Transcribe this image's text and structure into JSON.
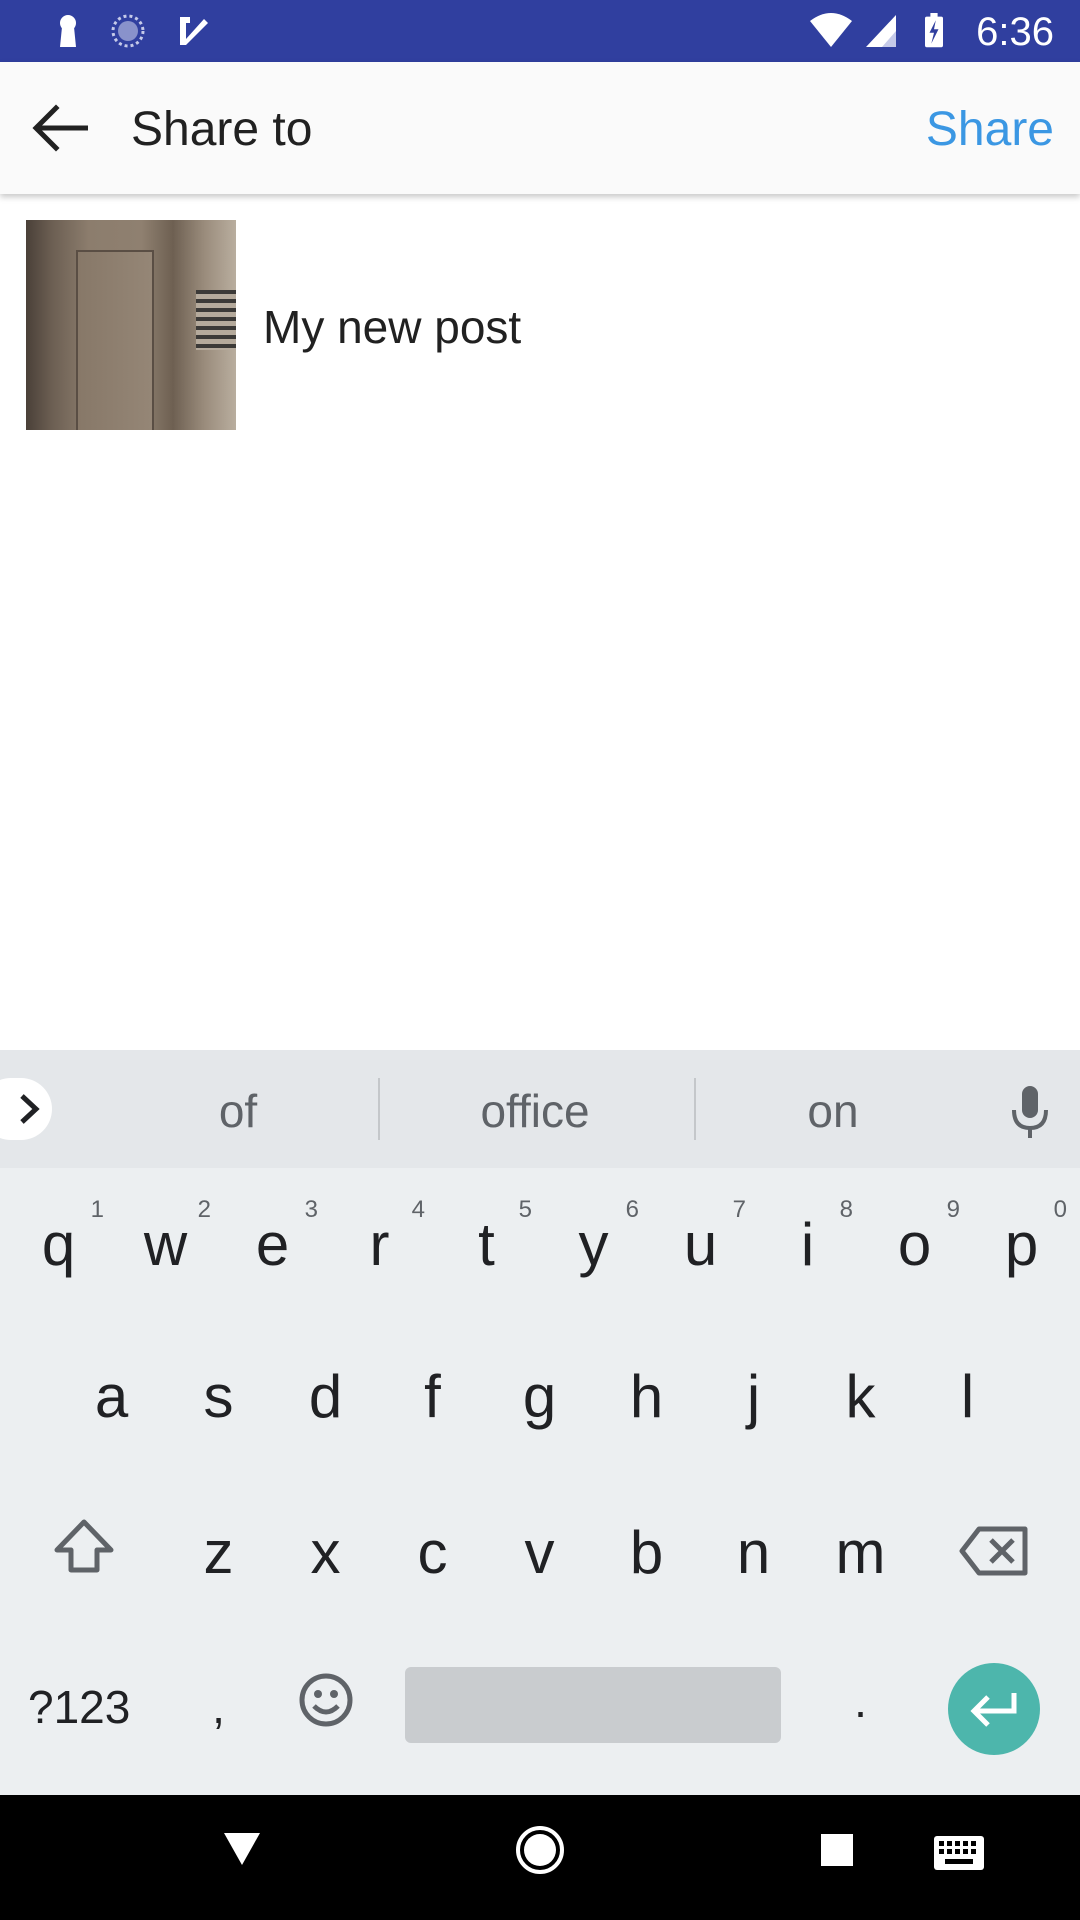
{
  "status_bar": {
    "time": "6:36",
    "icons_left": [
      "keyhole-icon",
      "loading-circle-icon",
      "check-icon"
    ],
    "icons_right": [
      "wifi-icon",
      "signal-icon",
      "battery-charging-icon"
    ],
    "bg_color": "#303f9f"
  },
  "app_bar": {
    "back_icon": "arrow-back-icon",
    "title": "Share to",
    "action_label": "Share",
    "action_color": "#3b97e3"
  },
  "post": {
    "caption": "My new post"
  },
  "keyboard": {
    "suggestions": [
      "of",
      "office",
      "on"
    ],
    "row1": [
      {
        "letter": "q",
        "hint": "1"
      },
      {
        "letter": "w",
        "hint": "2"
      },
      {
        "letter": "e",
        "hint": "3"
      },
      {
        "letter": "r",
        "hint": "4"
      },
      {
        "letter": "t",
        "hint": "5"
      },
      {
        "letter": "y",
        "hint": "6"
      },
      {
        "letter": "u",
        "hint": "7"
      },
      {
        "letter": "i",
        "hint": "8"
      },
      {
        "letter": "o",
        "hint": "9"
      },
      {
        "letter": "p",
        "hint": "0"
      }
    ],
    "row2": [
      "a",
      "s",
      "d",
      "f",
      "g",
      "h",
      "j",
      "k",
      "l"
    ],
    "row3": [
      "z",
      "x",
      "c",
      "v",
      "b",
      "n",
      "m"
    ],
    "symbols_label": "?123",
    "comma": ",",
    "period": ".",
    "enter_color": "#4db6ac"
  }
}
